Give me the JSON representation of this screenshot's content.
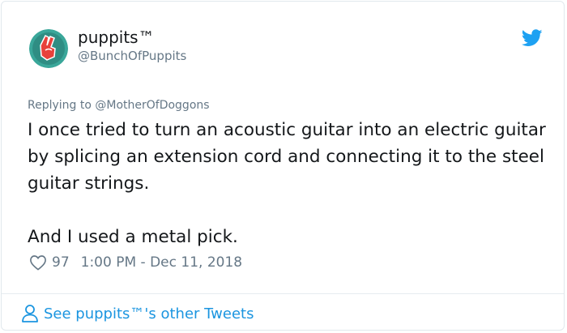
{
  "tweet": {
    "name": "puppits™",
    "handle": "@BunchOfPuppits",
    "replying_to": "Replying to @MotherOfDoggons",
    "body": "I once tried to turn an acoustic guitar into an electric guitar by splicing an extension cord and connecting it to the steel guitar strings.\n\nAnd I used a metal pick.",
    "likes": "97",
    "timestamp": "1:00 PM - Dec 11, 2018"
  },
  "footer": {
    "link_label": "See puppits™'s other Tweets"
  },
  "icons": {
    "brand": "twitter-bird-icon",
    "like": "heart-icon",
    "profile": "person-icon"
  },
  "colors": {
    "accent": "#1da1f2",
    "link": "#1b95e0",
    "muted": "#657786",
    "text": "#14171a"
  }
}
